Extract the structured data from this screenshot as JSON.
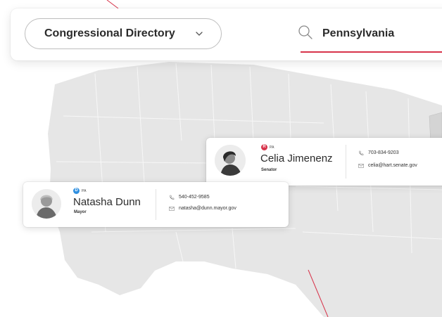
{
  "header": {
    "directory_label": "Congressional Directory",
    "search_value": "Pennsylvania"
  },
  "cards": [
    {
      "party": "R",
      "state": "PA",
      "name": "Celia Jimenenz",
      "role": "Senator",
      "phone": "703-834-9203",
      "email": "celia@hart.senate.gov"
    },
    {
      "party": "D",
      "state": "PA",
      "name": "Natasha Dunn",
      "role": "Mayor",
      "phone": "540-452-9585",
      "email": "natasha@dunn.mayor.gov"
    }
  ],
  "colors": {
    "accent_red": "#d7334a",
    "republican_badge": "#d7334a",
    "democrat_badge": "#2f8fe0",
    "map_fill": "#e6e6e6"
  },
  "icons": {
    "directory_chevron": "chevron-down-icon",
    "search": "search-icon",
    "phone": "phone-icon",
    "email": "email-icon"
  }
}
